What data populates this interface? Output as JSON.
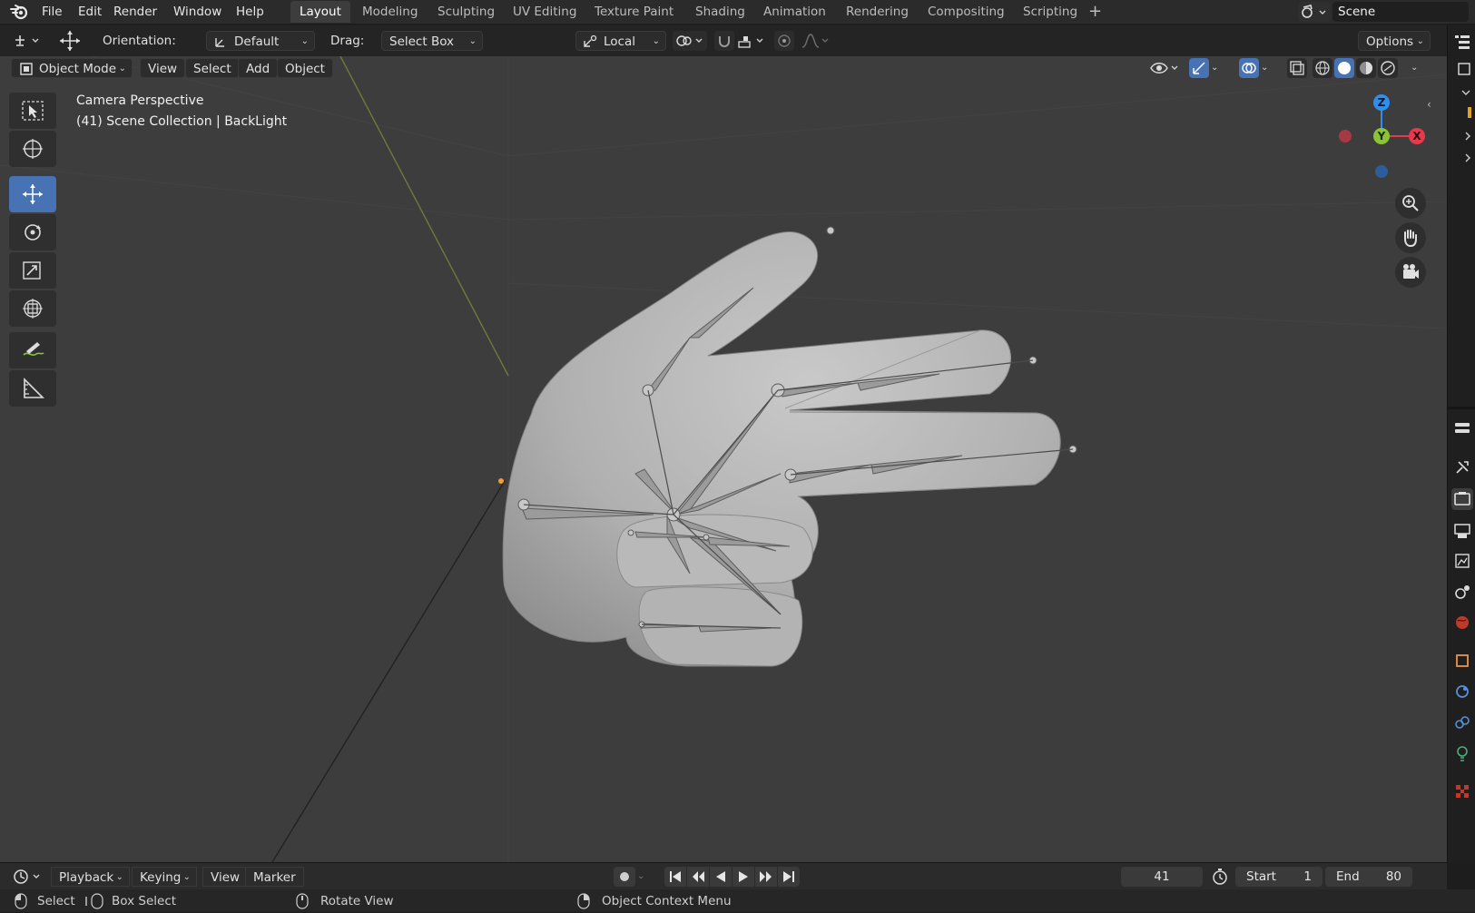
{
  "menu": {
    "items": [
      "File",
      "Edit",
      "Render",
      "Window",
      "Help"
    ]
  },
  "workspaces": {
    "tabs": [
      "Layout",
      "Modeling",
      "Sculpting",
      "UV Editing",
      "Texture Paint",
      "Shading",
      "Animation",
      "Rendering",
      "Compositing",
      "Scripting"
    ],
    "active": "Layout",
    "scene": "Scene"
  },
  "tool_header": {
    "orientation_label": "Orientation:",
    "orientation_value": "Default",
    "drag_label": "Drag:",
    "drag_value": "Select Box",
    "pivot_value": "Local",
    "options_label": "Options"
  },
  "viewport_header": {
    "mode": "Object Mode",
    "menus": [
      "View",
      "Select",
      "Add",
      "Object"
    ]
  },
  "viewport": {
    "camera_label": "Camera Perspective",
    "collection_label": "(41) Scene Collection | BackLight",
    "gizmo_axes": {
      "x": "X",
      "y": "Y",
      "z": "Z"
    }
  },
  "timeline": {
    "menus": [
      "Playback",
      "Keying",
      "View",
      "Marker"
    ],
    "current_frame": "41",
    "start_label": "Start",
    "start_value": "1",
    "end_label": "End",
    "end_value": "80"
  },
  "statusbar": {
    "select": "Select",
    "box_select": "Box Select",
    "rotate_view": "Rotate View",
    "context_menu": "Object Context Menu"
  },
  "colors": {
    "accent": "#4772b3",
    "axis_x": "#e8394c",
    "axis_y": "#8bc437",
    "axis_z": "#2f8fee"
  }
}
